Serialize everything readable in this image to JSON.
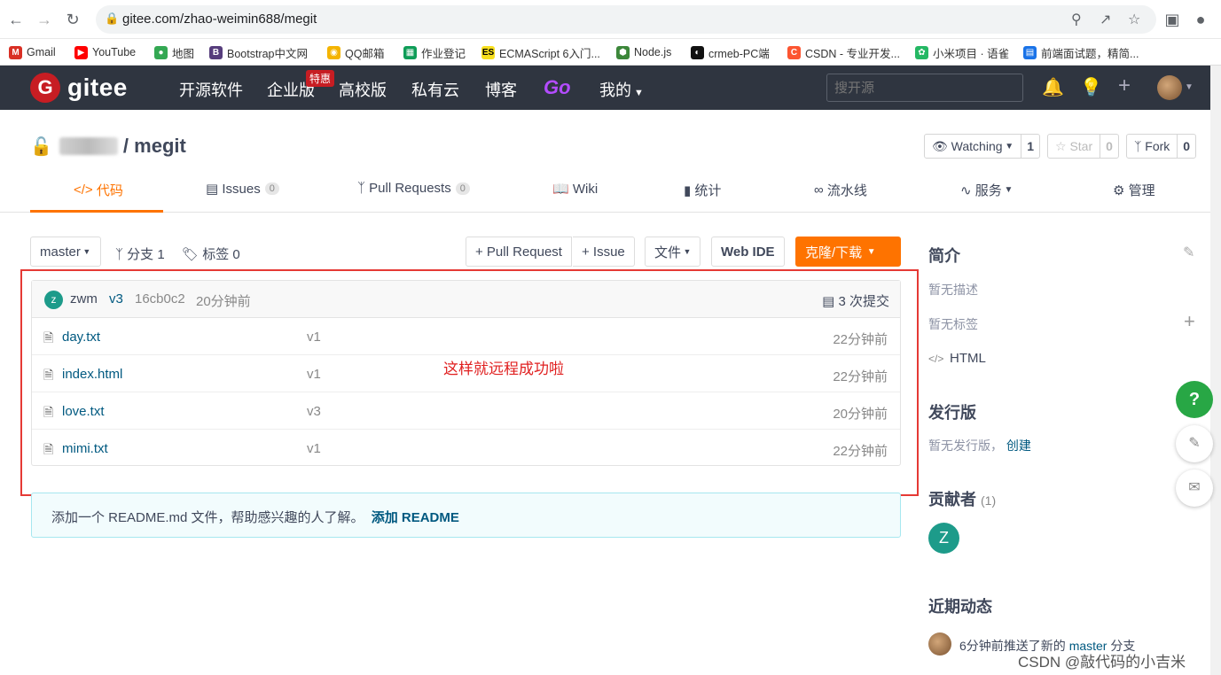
{
  "browser": {
    "url": "gitee.com/zhao-weimin688/megit",
    "bookmarks": [
      {
        "label": "Gmail",
        "icon": "gmail-icon",
        "color": "#d93025"
      },
      {
        "label": "YouTube",
        "icon": "youtube-icon",
        "color": "#ff0000"
      },
      {
        "label": "地图",
        "icon": "maps-icon",
        "color": "#34a853"
      },
      {
        "label": "Bootstrap中文网",
        "icon": "bootstrap-icon",
        "color": "#563d7c"
      },
      {
        "label": "QQ邮箱",
        "icon": "qqmail-icon",
        "color": "#f4b400"
      },
      {
        "label": "作业登记",
        "icon": "sheet-icon",
        "color": "#0f9d58"
      },
      {
        "label": "ECMAScript 6入门...",
        "icon": "es-icon",
        "color": "#f7df1e"
      },
      {
        "label": "Node.js",
        "icon": "node-icon",
        "color": "#3c873a"
      },
      {
        "label": "crmeb-PC端",
        "icon": "crmeb-icon",
        "color": "#111111"
      },
      {
        "label": "CSDN - 专业开发...",
        "icon": "csdn-icon",
        "color": "#fc5531"
      },
      {
        "label": "小米项目 · 语雀",
        "icon": "yuque-icon",
        "color": "#25b864"
      },
      {
        "label": "前端面试题，精简...",
        "icon": "doc-icon",
        "color": "#1a73e8"
      }
    ]
  },
  "header": {
    "logo_text": "gitee",
    "nav": [
      "开源软件",
      "企业版",
      "高校版",
      "私有云",
      "博客",
      "Go",
      "我的"
    ],
    "badge": "特惠",
    "search_placeholder": "搜开源"
  },
  "repo": {
    "name": "megit",
    "separator": "/",
    "watch_label": "Watching",
    "watch_count": "1",
    "star_label": "Star",
    "star_count": "0",
    "fork_label": "Fork",
    "fork_count": "0"
  },
  "tabs": {
    "code": "代码",
    "issues": "Issues",
    "issues_count": "0",
    "prs": "Pull Requests",
    "prs_count": "0",
    "wiki": "Wiki",
    "stats": "统计",
    "pipeline": "流水线",
    "service": "服务",
    "manage": "管理"
  },
  "toolbar": {
    "branch": "master",
    "branches": "分支 1",
    "tags": "标签 0",
    "pull_request": "+ Pull Request",
    "issue": "+ Issue",
    "file": "文件",
    "web_ide": "Web IDE",
    "clone": "克隆/下载"
  },
  "commit": {
    "avatar_letter": "z",
    "author": "zwm",
    "message": "v3",
    "hash": "16cb0c2",
    "time": "20分钟前",
    "count_label": "3 次提交"
  },
  "files": [
    {
      "name": "day.txt",
      "message": "v1",
      "time": "22分钟前"
    },
    {
      "name": "index.html",
      "message": "v1",
      "time": "22分钟前"
    },
    {
      "name": "love.txt",
      "message": "v3",
      "time": "20分钟前"
    },
    {
      "name": "mimi.txt",
      "message": "v1",
      "time": "22分钟前"
    }
  ],
  "annotation": "这样就远程成功啦",
  "readme_tip": {
    "text": "添加一个 README.md 文件，帮助感兴趣的人了解。",
    "link": "添加 README"
  },
  "sidebar": {
    "intro_title": "简介",
    "no_desc": "暂无描述",
    "no_tags": "暂无标签",
    "language": "HTML",
    "release_title": "发行版",
    "no_release": "暂无发行版，",
    "create": "创建",
    "contrib_title": "贡献者",
    "contrib_count": "(1)",
    "contrib_letter": "Z",
    "activity_title": "近期动态",
    "activity_text": "6分钟前推送了新的",
    "activity_branch": "master",
    "activity_suffix": "分支"
  },
  "floating": {
    "help": "?"
  },
  "watermark": "CSDN @敲代码的小吉米",
  "colors": {
    "accent": "#fe7300",
    "header_bg": "#2f3540",
    "brand": "#c71d23",
    "annotation": "#e02020"
  }
}
